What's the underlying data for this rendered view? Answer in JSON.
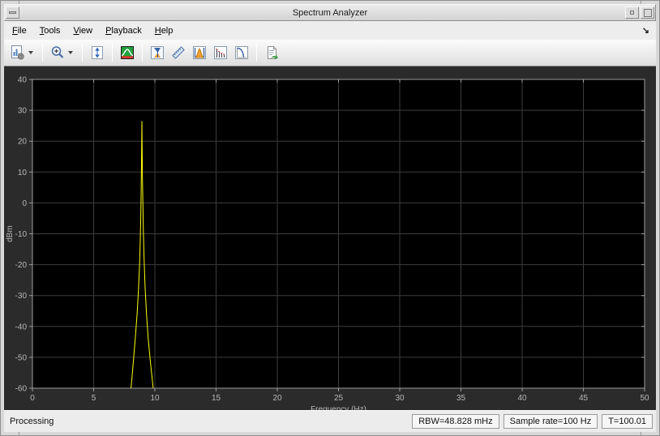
{
  "window": {
    "title": "Spectrum Analyzer"
  },
  "titlebar": {
    "title": "Spectrum Analyzer",
    "left_button_icon": "window-menu-dash-icon",
    "right_button_icons": [
      "minimize-icon",
      "maximize-icon"
    ]
  },
  "menubar": {
    "items": [
      {
        "label": "File"
      },
      {
        "label": "Tools"
      },
      {
        "label": "View"
      },
      {
        "label": "Playback"
      },
      {
        "label": "Help"
      }
    ],
    "overflow_glyph": "↘"
  },
  "toolbar": {
    "buttons": [
      {
        "icon": "spectrum-settings-icon",
        "has_dropdown": true
      },
      {
        "icon": "zoom-in-icon",
        "has_dropdown": true
      },
      {
        "icon": "scale-axes-icon"
      },
      {
        "icon": "spectral-mask-icon"
      },
      {
        "icon": "cursor-measurements-icon"
      },
      {
        "icon": "peak-ruler-icon"
      },
      {
        "icon": "channel-measurements-icon"
      },
      {
        "icon": "distortion-measurements-icon"
      },
      {
        "icon": "ccdf-measurements-icon"
      },
      {
        "icon": "export-icon"
      }
    ]
  },
  "plot": {
    "panel_bg": "#2b2b2b",
    "plot_bg": "#000000",
    "grid_color": "#3d3d3d",
    "box_color": "#9c9c9c",
    "tick_label_color": "#b8b8b8",
    "trace_color": "#ffff00"
  },
  "chart_data": {
    "type": "line",
    "title": "",
    "xlabel": "Frequency (Hz)",
    "ylabel": "dBm",
    "xlim": [
      0,
      50
    ],
    "ylim": [
      -60,
      40
    ],
    "xticks": [
      0,
      5,
      10,
      15,
      20,
      25,
      30,
      35,
      40,
      45,
      50
    ],
    "yticks": [
      -60,
      -50,
      -40,
      -30,
      -20,
      -10,
      0,
      10,
      20,
      30,
      40
    ],
    "grid": true,
    "legend": false,
    "series": [
      {
        "name": "spectrum-trace",
        "color": "#ffff00",
        "points": [
          [
            8.05,
            -60
          ],
          [
            8.25,
            -51
          ],
          [
            8.4,
            -44
          ],
          [
            8.55,
            -36
          ],
          [
            8.65,
            -29
          ],
          [
            8.74,
            -21
          ],
          [
            8.8,
            -13
          ],
          [
            8.85,
            -5
          ],
          [
            8.88,
            4
          ],
          [
            8.91,
            13
          ],
          [
            8.93,
            20
          ],
          [
            8.94,
            26.5
          ],
          [
            8.96,
            18
          ],
          [
            8.98,
            9
          ],
          [
            9.02,
            0
          ],
          [
            9.06,
            -9
          ],
          [
            9.12,
            -18
          ],
          [
            9.2,
            -27
          ],
          [
            9.32,
            -36
          ],
          [
            9.46,
            -44
          ],
          [
            9.62,
            -51
          ],
          [
            9.86,
            -60
          ]
        ]
      }
    ]
  },
  "statusbar": {
    "status": "Processing",
    "panels": [
      {
        "label": "RBW=48.828 mHz"
      },
      {
        "label": "Sample rate=100 Hz"
      },
      {
        "label": "T=100.01"
      }
    ]
  }
}
